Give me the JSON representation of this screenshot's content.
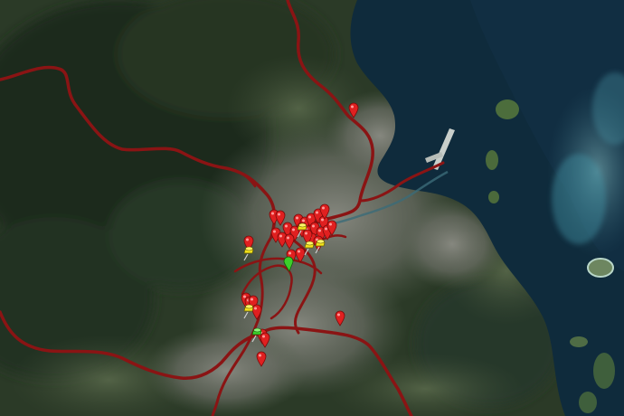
{
  "map": {
    "kind": "satellite imagery with route and pin overlays",
    "colors": {
      "forest_dark": "#1f2e1f",
      "forest_mid": "#2f4129",
      "farmland": "#4a5a40",
      "urban": "#76786f",
      "water_deep": "#0f2a3a",
      "water_shallow": "#3d7c8c",
      "route": "#8a1414",
      "pin_red": "#e02020",
      "pushpin_yellow": "#f2e21c",
      "pushpin_green": "#3ccf2a"
    },
    "routes": [
      "highway-north",
      "highway-west",
      "highway-south-west",
      "highway-south",
      "bay-road",
      "ring-road-a",
      "ring-road-b",
      "ring-road-c",
      "ring-road-d",
      "ring-road-e"
    ],
    "markers": {
      "red_pin_count": 34,
      "yellow_pushpin_count": 5,
      "green_pushpin_count": 2
    }
  }
}
